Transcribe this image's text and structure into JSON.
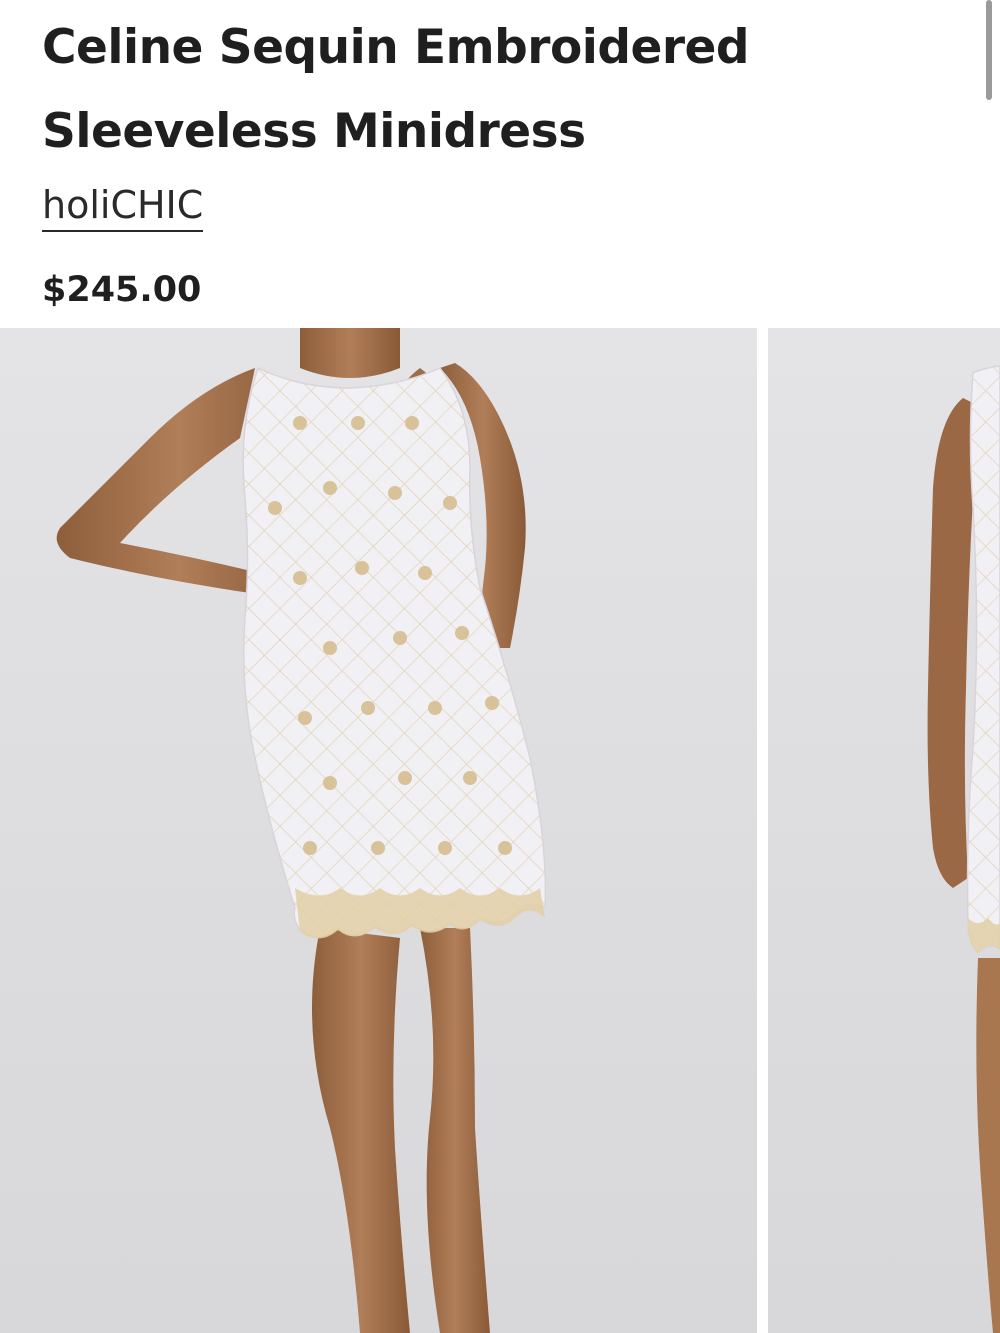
{
  "product": {
    "title": "Celine Sequin Embroidered Sleeveless Minidress",
    "brand": "holiCHIC",
    "price": "$245.00"
  },
  "gallery": {
    "images": [
      {
        "alt": "Celine Sequin Embroidered Sleeveless Minidress front view",
        "icon": "product-photo"
      },
      {
        "alt": "Celine Sequin Embroidered Sleeveless Minidress alternate view",
        "icon": "product-photo"
      }
    ]
  },
  "colors": {
    "text": "#1f1f1f",
    "background": "#ffffff",
    "photo_backdrop": "#dcdcde",
    "dress": "#f1f0f4",
    "embroidery": "#d8c29a",
    "skin": "#a8764f"
  }
}
